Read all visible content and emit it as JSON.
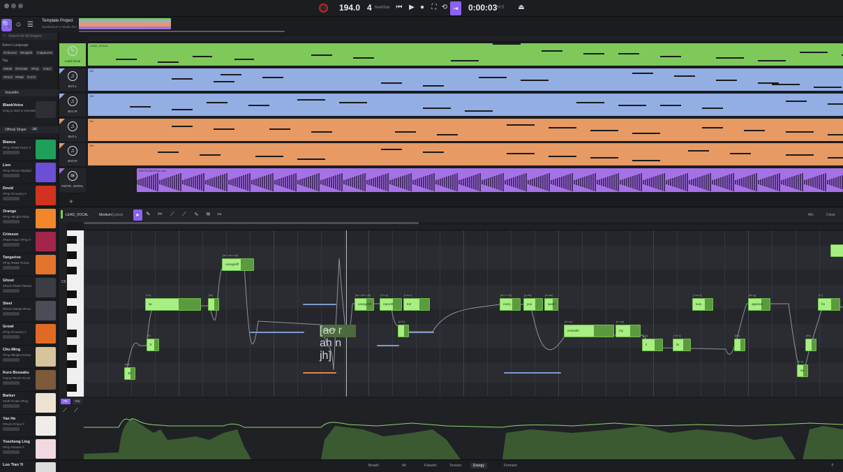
{
  "toolbar": {
    "tempo": "194.0",
    "beats": "4",
    "beats_unit": "beat/bar",
    "time": "0:00:03",
    "time_unit": "M:S"
  },
  "project": {
    "title": "Template Project",
    "subtitle": "Synthesizer V Studio Pro"
  },
  "sidebar": {
    "search_placeholder": "Search for All Singers",
    "language_header": "Select Language",
    "languages": [
      "#Chinese",
      "#English",
      "#Japanese"
    ],
    "tag_header": "Tag",
    "tags": [
      "#Male",
      "#Female",
      "#Pop",
      "#Jazz",
      "#Rock",
      "#R&B",
      "#ACG"
    ],
    "voicemix_header": "VoiceMix",
    "blank_voice": "BlankVoice",
    "blank_voice_hint": "Drag to start a VoiceMix",
    "official_header": "Official Singer",
    "official_count": "18",
    "singers": [
      {
        "name": "Bianca",
        "sub": "#Pop #R&B #Jazz #"
      },
      {
        "name": "Lien",
        "sub": "#Pop #Rock #Ballad"
      },
      {
        "name": "Devid",
        "sub": "#Pop #Country #"
      },
      {
        "name": "Orange",
        "sub": "#Pop #Bright #Elec"
      },
      {
        "name": "Crimson",
        "sub": "#R&B #Jazz #Pop #"
      },
      {
        "name": "Tangerine",
        "sub": "#Pop #R&B #Clear"
      },
      {
        "name": "Ghost",
        "sub": "#Rock #Dark #Metal"
      },
      {
        "name": "Steel",
        "sub": "#Rock #Metal #Pow"
      },
      {
        "name": "Growl",
        "sub": "#Pop #Country #"
      },
      {
        "name": "Chu Ming",
        "sub": "#Pop #Bright #Clear"
      },
      {
        "name": "Kuro Bousaku",
        "sub": "#Jpop #Rock #Cool"
      },
      {
        "name": "Barber",
        "sub": "#Soft #Calm #Pop"
      },
      {
        "name": "Yan He",
        "sub": "#Rock #Clear #"
      },
      {
        "name": "Yuezheng Ling",
        "sub": "#Pop #Sweet #"
      },
      {
        "name": "Luo Tian Yi",
        "sub": ""
      }
    ]
  },
  "tracks": [
    {
      "name": "Lead Vocal",
      "clip_title": "LEAD_VOCAL",
      "color": "#7fc95a"
    },
    {
      "name": "BV1-L",
      "clip_title": "BV",
      "color": "#93aee3"
    },
    {
      "name": "BV1-R",
      "clip_title": "BV",
      "color": "#93aee3"
    },
    {
      "name": "BV2-L",
      "clip_title": "BV",
      "color": "#e79a63"
    },
    {
      "name": "BV2-R",
      "clip_title": "BV",
      "color": "#e79a63"
    },
    {
      "name": "INSTR...ENTAL",
      "clip_title": "INSTRUMENTAL.wav",
      "color": "#a571e6"
    }
  ],
  "editor": {
    "track_label": "LEAD_VOCAL",
    "mode_label": "Medium",
    "mode_value": "(Lyrics)",
    "side_left": "Mix",
    "side_right": "Close"
  },
  "piano": {
    "octave_label": "C5"
  },
  "notes": [
    {
      "lyric": "ah",
      "phoneme": "[aa]"
    },
    {
      "lyric": "tr",
      "phoneme": "[tr]"
    },
    {
      "lyric": "tw",
      "phoneme": "[t w]"
    },
    {
      "lyric": "orangeriff",
      "phoneme": "[ao r ah n jh]"
    },
    {
      "lyric": "",
      "phoneme": "[tw]"
    },
    {
      "lyric": "",
      "phoneme": ""
    },
    {
      "lyric": "orangeriff",
      "phoneme": "[ao r ah n jh]"
    },
    {
      "lyric": "orangeriff",
      "phoneme": "[ao r ah n jh]"
    },
    {
      "lyric": "reportIt",
      "phoneme": "[r ih p]"
    },
    {
      "lyric": "torr",
      "phoneme": "[t ao r]"
    },
    {
      "lyric": "",
      "phoneme": "[d ih]"
    },
    {
      "lyric": "every",
      "phoneme": "[eh v r iy]"
    },
    {
      "lyric": "you",
      "phoneme": "[y uw]"
    },
    {
      "lyric": "wantI",
      "phoneme": "[w aa]"
    },
    {
      "lyric": "",
      "phoneme": "[w aa]"
    },
    {
      "lyric": "eowsath",
      "phoneme": "[eh w]"
    },
    {
      "lyric": "my",
      "phoneme": "[m ay]"
    },
    {
      "lyric": "li",
      "phoneme": "[l iy]"
    },
    {
      "lyric": "liv",
      "phoneme": "[l ih v]"
    },
    {
      "lyric": "li",
      "phoneme": "[l ih]"
    },
    {
      "lyric": "luse",
      "phoneme": "[l uw s]"
    },
    {
      "lyric": "aganeal",
      "phoneme": "[ah g]"
    },
    {
      "lyric": "",
      "phoneme": "[eh]"
    },
    {
      "lyric": "ws",
      "phoneme": "[w s]"
    },
    {
      "lyric": "",
      "phoneme": "[eh]"
    },
    {
      "lyric": "fre",
      "phoneme": "[f r]"
    }
  ],
  "param_panel": {
    "btn_a": "Ptc",
    "btn_b": "Par"
  },
  "param_tabs": [
    "Breath",
    "Air",
    "Falsetto",
    "Tension",
    "Energy",
    "Formant"
  ],
  "active_param_tab": "Energy",
  "colors": {
    "accent": "#8b63f0",
    "note": "#a7ef82",
    "lead": "#7fc95a",
    "bv1": "#93aee3",
    "bv2": "#e79a63",
    "instr": "#a571e6"
  }
}
